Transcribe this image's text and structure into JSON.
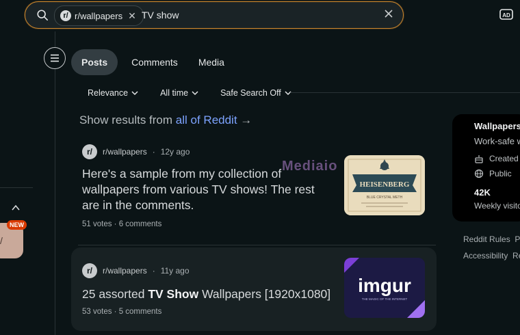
{
  "search": {
    "community_chip": "r/wallpapers",
    "query": "TV show"
  },
  "tabs": [
    {
      "label": "Posts",
      "active": true
    },
    {
      "label": "Comments",
      "active": false
    },
    {
      "label": "Media",
      "active": false
    }
  ],
  "filters": {
    "sort": "Relevance",
    "time": "All time",
    "safe_search": "Safe Search Off"
  },
  "results_banner": {
    "prefix": "Show results from",
    "link": "all of Reddit",
    "arrow": "→"
  },
  "posts": [
    {
      "subreddit": "r/wallpapers",
      "age": "12y ago",
      "title": "Here's a sample from my collection of wallpapers from various TV shows! The rest are in the comments.",
      "stats": "51 votes · 6 comments",
      "thumb_text": "HEISENBERG",
      "thumb_subtext": "BLUE CRYSTAL METH"
    },
    {
      "subreddit": "r/wallpapers",
      "age": "11y ago",
      "title_before": "25 assorted ",
      "title_bold": "TV Show",
      "title_after": " Wallpapers [1920x1080]",
      "stats": "53 votes · 5 comments",
      "thumb_text": "imgur",
      "thumb_subtext": "THE MAGIC OF THE INTERNET"
    }
  ],
  "sidebar_card": {
    "title": "Wallpapers",
    "subtitle": "Work-safe w",
    "created": "Created",
    "visibility": "Public",
    "members": "42K",
    "members_label": "Weekly visito"
  },
  "footer_links": {
    "row1a": "Reddit Rules",
    "row1b": "Pr",
    "row2a": "Accessibility",
    "row2b": "Re"
  },
  "left_rail": {
    "badge": "NEW"
  },
  "watermark": "Mediaio",
  "colors": {
    "background": "#0b1416",
    "search_border": "#c9852d",
    "link": "#7da3ff",
    "active_tab": "#333d42"
  }
}
